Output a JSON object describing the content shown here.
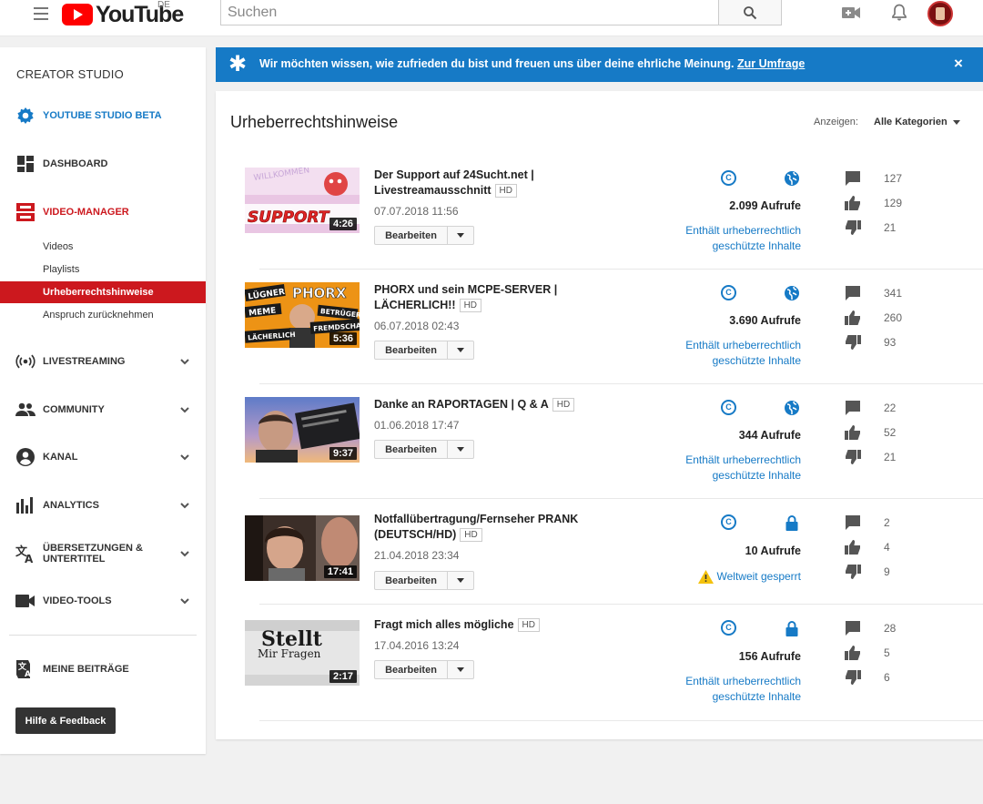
{
  "header": {
    "logo_text": "YouTube",
    "country": "DE",
    "search_placeholder": "Suchen"
  },
  "sidebar": {
    "title": "CREATOR STUDIO",
    "studio_beta": "YOUTUBE STUDIO BETA",
    "dashboard": "DASHBOARD",
    "video_manager": "VIDEO-MANAGER",
    "sub_items": [
      "Videos",
      "Playlists",
      "Urheberrechtshinweise",
      "Anspruch zurücknehmen"
    ],
    "livestreaming": "LIVESTREAMING",
    "community": "COMMUNITY",
    "kanal": "KANAL",
    "analytics": "ANALYTICS",
    "uebersetzungen_line1": "ÜBERSETZUNGEN &",
    "uebersetzungen_line2": "UNTERTITEL",
    "video_tools": "VIDEO-TOOLS",
    "meine_beitraege": "MEINE BEITRÄGE",
    "help_button": "Hilfe & Feedback"
  },
  "banner": {
    "text": "Wir möchten wissen, wie zufrieden du bist und freuen uns über deine ehrliche Meinung.",
    "link": "Zur Umfrage",
    "close": "×"
  },
  "main": {
    "title": "Urheberrechtshinweise",
    "filter_label": "Anzeigen:",
    "filter_value": "Alle Kategorien",
    "edit_label": "Bearbeiten",
    "hd_label": "HD",
    "copyright_glyph": "C"
  },
  "videos": [
    {
      "title": "Der Support auf 24Sucht.net | Livestreamausschnitt",
      "date": "07.07.2018 11:56",
      "duration": "4:26",
      "thumb_text": "SUPPORT",
      "views": "2.099 Aufrufe",
      "visibility": "public",
      "status_line1": "Enthält urheberrechtlich",
      "status_line2": "geschützte Inhalte",
      "comments": "127",
      "likes": "129",
      "dislikes": "21"
    },
    {
      "title": "PHORX und sein MCPE-SERVER | LÄCHERLICH!!",
      "date": "06.07.2018 02:43",
      "duration": "5:36",
      "thumb_text": "PHORX",
      "thumb_words": [
        "LÜGNER",
        "MEME",
        "BETRÜGER",
        "FREMDSCHAM",
        "LÄCHERLICH"
      ],
      "views": "3.690 Aufrufe",
      "visibility": "public",
      "status_line1": "Enthält urheberrechtlich",
      "status_line2": "geschützte Inhalte",
      "comments": "341",
      "likes": "260",
      "dislikes": "93"
    },
    {
      "title": "Danke an RAPORTAGEN | Q & A",
      "date": "01.06.2018 17:47",
      "duration": "9:37",
      "views": "344 Aufrufe",
      "visibility": "public",
      "status_line1": "Enthält urheberrechtlich",
      "status_line2": "geschützte Inhalte",
      "comments": "22",
      "likes": "52",
      "dislikes": "21"
    },
    {
      "title": "Notfallübertragung/Fernseher PRANK (DEUTSCH/HD)",
      "date": "21.04.2018 23:34",
      "duration": "17:41",
      "views": "10 Aufrufe",
      "visibility": "private",
      "status_line1": "Weltweit gesperrt",
      "status_line2": "",
      "comments": "2",
      "likes": "4",
      "dislikes": "9"
    },
    {
      "title": "Fragt mich alles mögliche",
      "date": "17.04.2016 13:24",
      "duration": "2:17",
      "thumb_text": "Stellt",
      "thumb_text2": "Mir Fragen",
      "views": "156 Aufrufe",
      "visibility": "private",
      "status_line1": "Enthält urheberrechtlich",
      "status_line2": "geschützte Inhalte",
      "comments": "28",
      "likes": "5",
      "dislikes": "6"
    }
  ],
  "colors": {
    "accent_blue": "#167ac6",
    "youtube_red": "#ff0000",
    "active_red": "#cc181e",
    "warning_yellow": "#f4c20d"
  }
}
